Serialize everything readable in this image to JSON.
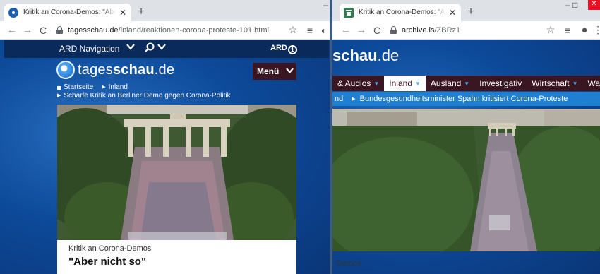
{
  "left": {
    "tab": {
      "title": "Kritik an Corona-Demos: \"Aber nicht so\"",
      "close": "✕",
      "new_tab": "+"
    },
    "address": {
      "host": "tagesschau.de",
      "path": "/inland/reaktionen-corona-proteste-101.html"
    },
    "toolbar": {
      "back": "←",
      "forward": "→",
      "reload": "C",
      "star": "☆",
      "queue": "≡",
      "extension": "◐"
    },
    "ard_bar": {
      "nav_label": "ARD Navigation",
      "logo": "ARD"
    },
    "site": {
      "logo_regular": "tages",
      "logo_bold": "schau",
      "logo_suffix": ".de",
      "menu_label": "Menü"
    },
    "breadcrumbs": [
      "Startseite",
      "Inland",
      "Scharfe Kritik an Berliner Demo gegen Corona-Politik"
    ],
    "article": {
      "kicker": "Kritik an Corona-Demos",
      "headline": "\"Aber nicht so\""
    },
    "window_controls": "–"
  },
  "right": {
    "tab": {
      "title": "Kritik an Corona-Demos: \"Aber nicht so\"",
      "close": "✕",
      "new_tab": "+"
    },
    "address": {
      "host": "archive.is",
      "path": "/ZBRz1"
    },
    "toolbar": {
      "back": "←",
      "forward": "→",
      "reload": "C",
      "star": "☆",
      "queue": "≡",
      "account": "●"
    },
    "site": {
      "logo_bold": "schau",
      "logo_suffix": ".de"
    },
    "nav_items": [
      {
        "label": "& Audios",
        "caret": true,
        "active": false
      },
      {
        "label": "Inland",
        "caret": true,
        "active": true
      },
      {
        "label": "Ausland",
        "caret": true,
        "active": false
      },
      {
        "label": "Investigativ",
        "caret": false,
        "active": false
      },
      {
        "label": "Wirtschaft",
        "caret": true,
        "active": false
      },
      {
        "label": "Wahlen",
        "caret": false,
        "active": false
      }
    ],
    "breadcrumb": {
      "previous": "nd",
      "current": "Bundesgesundheitsminister Spahn kritisiert Corona-Proteste"
    },
    "article": {
      "kicker": "-Demos"
    },
    "window_controls": "– □"
  },
  "colors": {
    "page_blue": "#0d4a9a",
    "ard_bar": "#0a2a5c",
    "nav_burgundy": "#3a1522",
    "crumb_blue": "#1f7fd0",
    "nav_caret": "#5aa7ea"
  },
  "icons": [
    "tagesschau-favicon",
    "archive-favicon",
    "lock-icon",
    "search-icon",
    "chevron-down-icon",
    "star-icon",
    "reading-list-icon",
    "account-icon"
  ]
}
